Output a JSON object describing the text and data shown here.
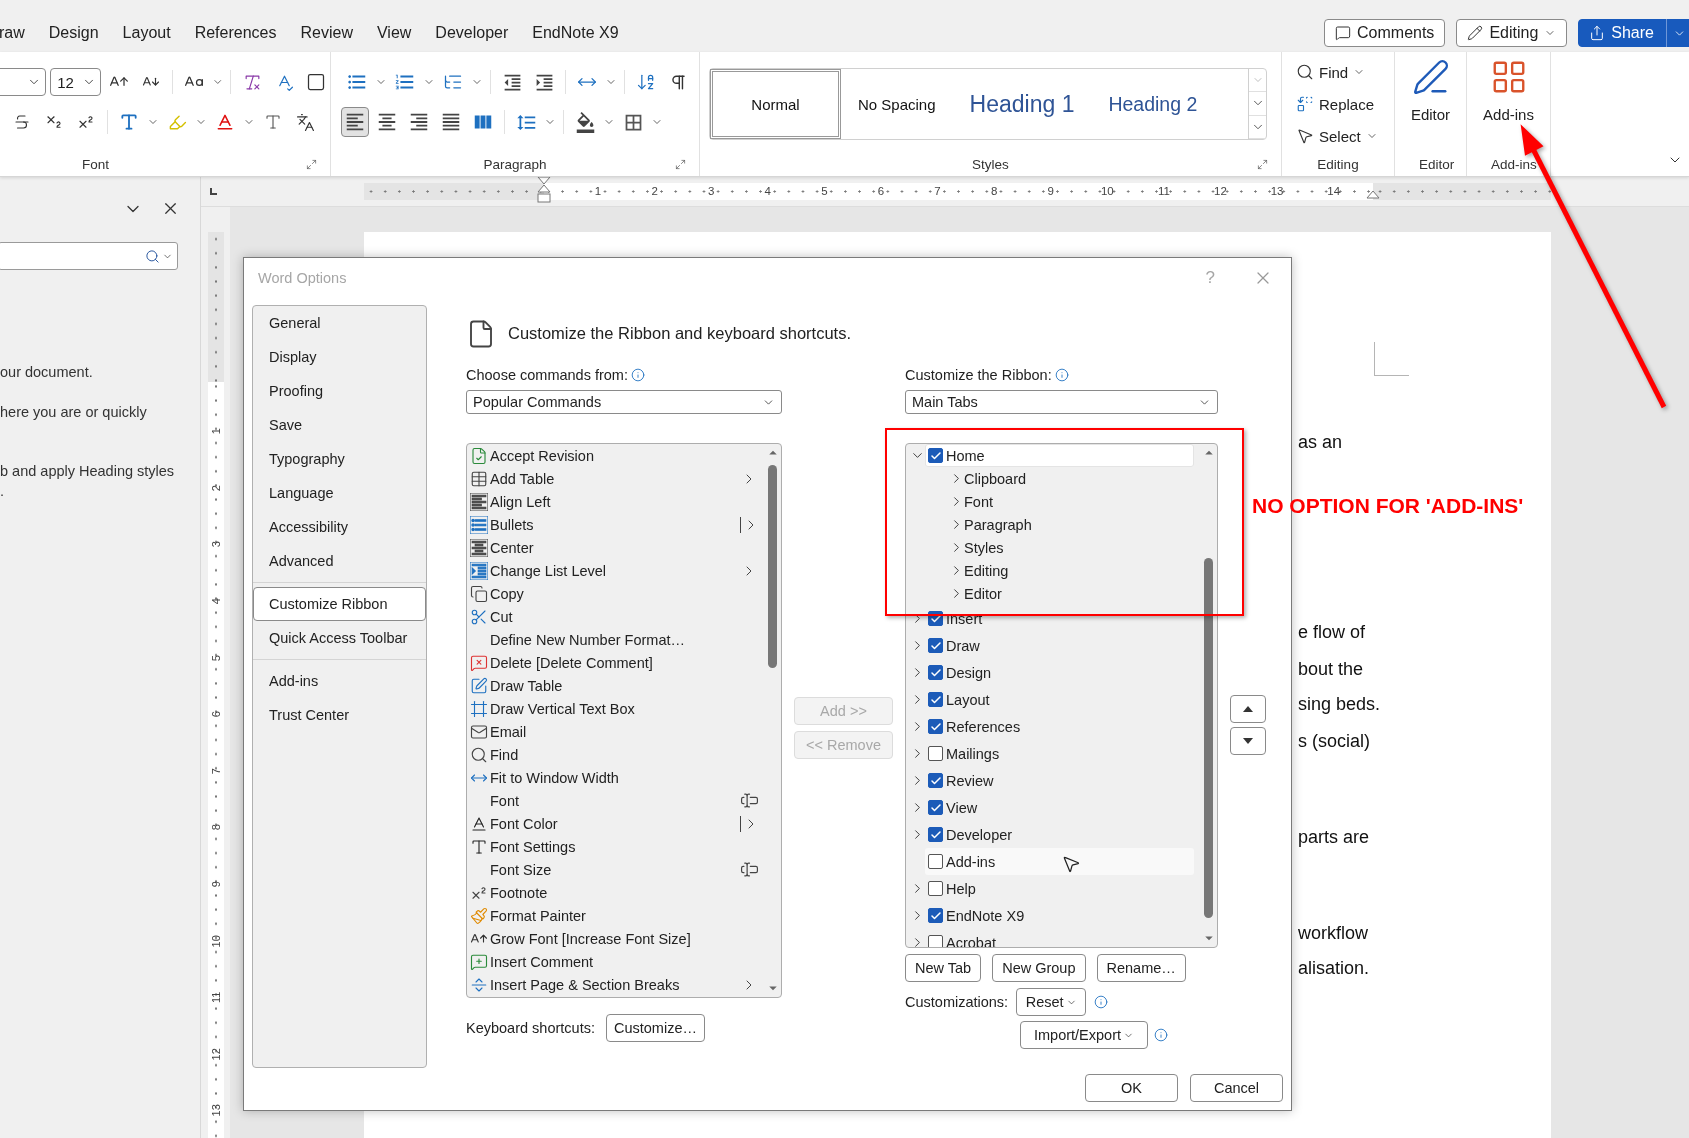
{
  "ribbon_tabs": [
    {
      "label": "raw"
    },
    {
      "label": "Design"
    },
    {
      "label": "Layout"
    },
    {
      "label": "References"
    },
    {
      "label": "Review"
    },
    {
      "label": "View"
    },
    {
      "label": "Developer"
    },
    {
      "label": "EndNote X9"
    }
  ],
  "top_buttons": [
    {
      "label": "Comments",
      "kind": "comments"
    },
    {
      "label": "Editing",
      "kind": "mode"
    },
    {
      "label": "Share",
      "kind": "share"
    }
  ],
  "ribbon": {
    "font_size": "12",
    "align_buttons": [
      {
        "selected": true
      },
      {
        "selected": false
      },
      {
        "selected": false
      },
      {
        "selected": false
      },
      {
        "selected": false
      }
    ],
    "groups": [
      {
        "label": "Font"
      },
      {
        "label": "Paragraph"
      },
      {
        "label": "Styles"
      },
      {
        "label": "Editing"
      },
      {
        "label": "Editor"
      },
      {
        "label": "Add-ins"
      }
    ],
    "styles": [
      {
        "label": "Normal",
        "kind": "normal",
        "selected": true
      },
      {
        "label": "No Spacing",
        "kind": "normal",
        "selected": false
      },
      {
        "label": "Heading 1",
        "kind": "heading1",
        "selected": false
      },
      {
        "label": "Heading 2",
        "kind": "heading2",
        "selected": false
      }
    ],
    "editing": [
      {
        "label": "Find",
        "kind": "find"
      },
      {
        "label": "Replace",
        "kind": "replace"
      },
      {
        "label": "Select",
        "kind": "select"
      }
    ],
    "editor_button": "Editor",
    "addins_button": "Add-ins"
  },
  "ruler": {
    "numbers": [
      "1",
      "2",
      "3",
      "4",
      "5",
      "6",
      "7",
      "8",
      "9",
      "10",
      "11",
      "12",
      "13",
      "14"
    ]
  },
  "vertical_ruler": {
    "numbers": [
      "1",
      "2",
      "3",
      "4",
      "5",
      "6",
      "7",
      "8",
      "9",
      "10",
      "11",
      "12",
      "13"
    ]
  },
  "navigation_pane": {
    "lines": [
      "our document.",
      "here you are or quickly",
      "b and apply Heading styles",
      "."
    ]
  },
  "document": {
    "lines": [
      "as an",
      "e flow of",
      "bout the",
      "sing beds.",
      "s (social)",
      "parts are",
      "workflow",
      "alisation."
    ]
  },
  "dialog": {
    "title": "Word Options",
    "help": "?",
    "nav": [
      {
        "items": [
          {
            "label": "General",
            "selected": false
          },
          {
            "label": "Display",
            "selected": false
          },
          {
            "label": "Proofing",
            "selected": false
          },
          {
            "label": "Save",
            "selected": false
          },
          {
            "label": "Typography",
            "selected": false
          },
          {
            "label": "Language",
            "selected": false
          },
          {
            "label": "Accessibility",
            "selected": false
          },
          {
            "label": "Advanced",
            "selected": false
          }
        ]
      },
      {
        "items": [
          {
            "label": "Customize Ribbon",
            "selected": true
          },
          {
            "label": "Quick Access Toolbar",
            "selected": false
          }
        ]
      },
      {
        "items": [
          {
            "label": "Add-ins",
            "selected": false
          },
          {
            "label": "Trust Center",
            "selected": false
          }
        ]
      }
    ],
    "heading": "Customize the Ribbon and keyboard shortcuts.",
    "commands_label": "Choose commands from:",
    "commands_value": "Popular Commands",
    "commands": [
      {
        "label": "Accept Revision",
        "kind": "plain"
      },
      {
        "label": "Add Table",
        "kind": "submenu"
      },
      {
        "label": "Align Left",
        "kind": "plain"
      },
      {
        "label": "Bullets",
        "kind": "split"
      },
      {
        "label": "Center",
        "kind": "plain"
      },
      {
        "label": "Change List Level",
        "kind": "submenu"
      },
      {
        "label": "Copy",
        "kind": "plain"
      },
      {
        "label": "Cut",
        "kind": "plain"
      },
      {
        "label": "Define New Number Format…",
        "kind": "plain"
      },
      {
        "label": "Delete [Delete Comment]",
        "kind": "plain"
      },
      {
        "label": "Draw Table",
        "kind": "plain"
      },
      {
        "label": "Draw Vertical Text Box",
        "kind": "plain"
      },
      {
        "label": "Email",
        "kind": "plain"
      },
      {
        "label": "Find",
        "kind": "plain"
      },
      {
        "label": "Fit to Window Width",
        "kind": "plain"
      },
      {
        "label": "Font",
        "kind": "field"
      },
      {
        "label": "Font Color",
        "kind": "split"
      },
      {
        "label": "Font Settings",
        "kind": "plain"
      },
      {
        "label": "Font Size",
        "kind": "field"
      },
      {
        "label": "Footnote",
        "kind": "plain"
      },
      {
        "label": "Format Painter",
        "kind": "plain"
      },
      {
        "label": "Grow Font [Increase Font Size]",
        "kind": "plain"
      },
      {
        "label": "Insert Comment",
        "kind": "plain"
      },
      {
        "label": "Insert Page & Section Breaks",
        "kind": "submenu"
      }
    ],
    "add_button": {
      "label": "Add >>",
      "disabled": true
    },
    "remove_button": {
      "label": "<< Remove",
      "disabled": true
    },
    "ribbon_label": "Customize the Ribbon:",
    "ribbon_value": "Main Tabs",
    "tabs": [
      {
        "label": "Home",
        "checked": true,
        "expandable": true,
        "expanded": true,
        "selected": true,
        "hovered": false,
        "children": [
          {
            "label": "Clipboard",
            "expanded": false
          },
          {
            "label": "Font",
            "expanded": false
          },
          {
            "label": "Paragraph",
            "expanded": false
          },
          {
            "label": "Styles",
            "expanded": false
          },
          {
            "label": "Editing",
            "expanded": false
          },
          {
            "label": "Editor",
            "expanded": false
          }
        ]
      },
      {
        "label": "Insert",
        "checked": true,
        "expandable": true,
        "expanded": false,
        "selected": false,
        "hovered": false
      },
      {
        "label": "Draw",
        "checked": true,
        "expandable": true,
        "expanded": false,
        "selected": false,
        "hovered": false
      },
      {
        "label": "Design",
        "checked": true,
        "expandable": true,
        "expanded": false,
        "selected": false,
        "hovered": false
      },
      {
        "label": "Layout",
        "checked": true,
        "expandable": true,
        "expanded": false,
        "selected": false,
        "hovered": false
      },
      {
        "label": "References",
        "checked": true,
        "expandable": true,
        "expanded": false,
        "selected": false,
        "hovered": false
      },
      {
        "label": "Mailings",
        "checked": false,
        "expandable": true,
        "expanded": false,
        "selected": false,
        "hovered": false
      },
      {
        "label": "Review",
        "checked": true,
        "expandable": true,
        "expanded": false,
        "selected": false,
        "hovered": false
      },
      {
        "label": "View",
        "checked": true,
        "expandable": true,
        "expanded": false,
        "selected": false,
        "hovered": false
      },
      {
        "label": "Developer",
        "checked": true,
        "expandable": true,
        "expanded": false,
        "selected": false,
        "hovered": false
      },
      {
        "label": "Add-ins",
        "checked": false,
        "expandable": false,
        "expanded": false,
        "selected": false,
        "hovered": true
      },
      {
        "label": "Help",
        "checked": false,
        "expandable": true,
        "expanded": false,
        "selected": false,
        "hovered": false
      },
      {
        "label": "EndNote X9",
        "checked": true,
        "expandable": true,
        "expanded": false,
        "selected": false,
        "hovered": false
      },
      {
        "label": "Acrobat",
        "checked": false,
        "expandable": true,
        "expanded": false,
        "selected": false,
        "hovered": false
      }
    ],
    "tree_buttons": [
      "New Tab",
      "New Group",
      "Rename…"
    ],
    "customizations_label": "Customizations:",
    "reset_button": "Reset",
    "import_export_button": "Import/Export",
    "shortcuts_label": "Keyboard shortcuts:",
    "shortcuts_button": "Customize…",
    "ok_button": "OK",
    "cancel_button": "Cancel"
  },
  "annotation": {
    "text": "NO OPTION FOR 'ADD-INS'"
  }
}
